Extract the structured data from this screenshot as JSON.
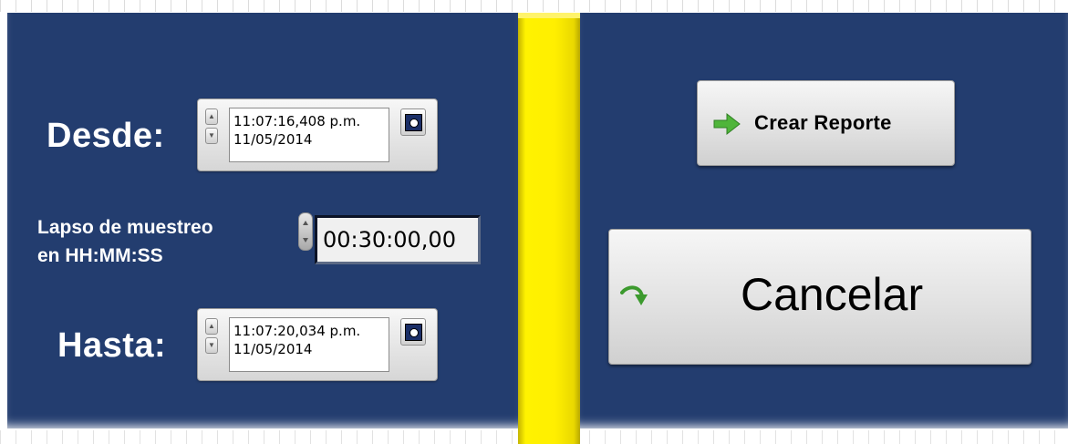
{
  "desde": {
    "label": "Desde:",
    "time": "11:07:16,408 p.m.",
    "date": "11/05/2014"
  },
  "lapso": {
    "label_line1": "Lapso de muestreo",
    "label_line2": "en HH:MM:SS",
    "value": "00:30:00,00"
  },
  "hasta": {
    "label": "Hasta:",
    "time": "11:07:20,034 p.m.",
    "date": "11/05/2014"
  },
  "buttons": {
    "report_label": "Crear  Reporte",
    "cancel_label": "Cancelar"
  },
  "icons": {
    "report": "green-arrow-right-icon",
    "cancel": "green-return-arrow-icon",
    "calendar": "calendar-clock-icon"
  },
  "colors": {
    "panel": "#233d6f",
    "divider": "#fff200",
    "label_text": "#ffffff"
  }
}
